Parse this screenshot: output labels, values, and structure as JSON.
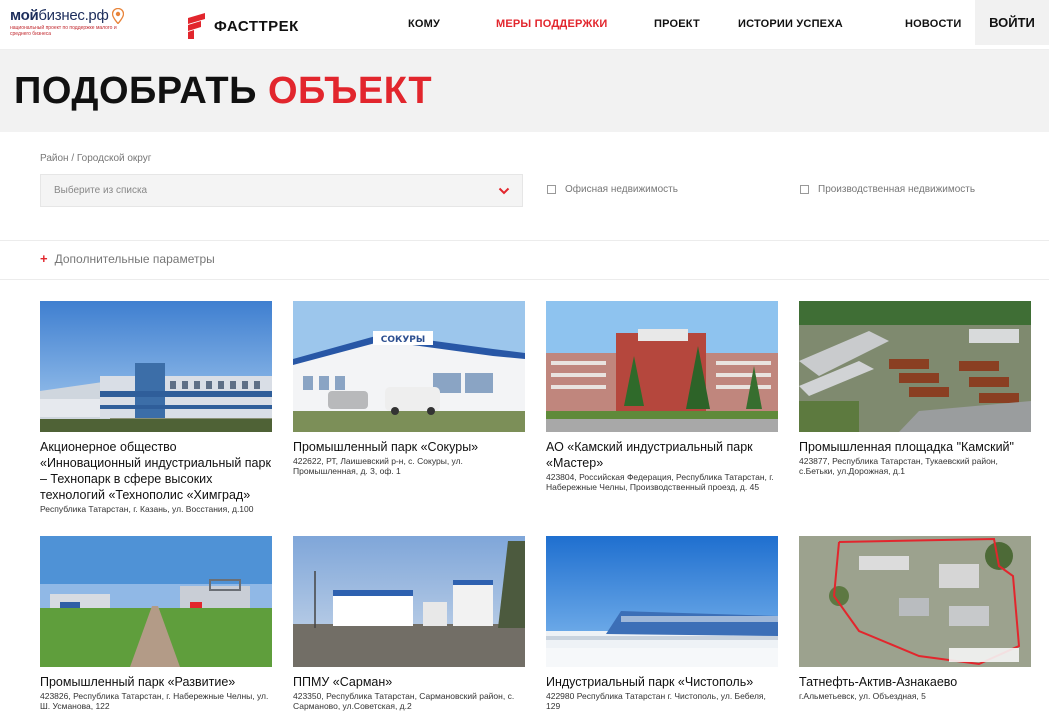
{
  "header": {
    "mb_logo": {
      "main_bold": "мой",
      "main_light": "бизнес.рф",
      "subtitle": "национальный проект по поддержке малого и среднего бизнеса"
    },
    "ft_logo": {
      "text": "ФАСТТРЕК"
    },
    "nav": [
      {
        "label": "КОМУ",
        "active": false
      },
      {
        "label": "МЕРЫ ПОДДЕРЖКИ",
        "active": true
      },
      {
        "label": "ПРОЕКТ",
        "active": false
      },
      {
        "label": "ИСТОРИИ УСПЕХА",
        "active": false
      },
      {
        "label": "НОВОСТИ",
        "active": false
      }
    ],
    "login": "ВОЙТИ"
  },
  "page": {
    "title_black": "ПОДОБРАТЬ ",
    "title_red": "ОБЪЕКТ"
  },
  "filters": {
    "district_label": "Район / Городской округ",
    "district_placeholder": "Выберите из списка",
    "office_label": "Офисная недвижимость",
    "production_label": "Производственная недвижимость",
    "extra_params": "Дополнительные параметры"
  },
  "cards": [
    {
      "title": "Акционерное общество «Инновационный индустриальный парк – Технопарк в сфере высоких технологий «Технополис «Химград»",
      "address": "Республика Татарстан, г. Казань, ул. Восстания, д.100"
    },
    {
      "title": "Промышленный парк «Сокуры»",
      "address": "422622, РТ, Лаишевский р-н, с. Сокуры, ул. Промышленная, д. 3, оф. 1",
      "sign": "СОКУРЫ"
    },
    {
      "title": "АО «Камский индустриальный парк «Мастер»",
      "address": "423804, Российская Федерация, Республика Татарстан, г. Набережные Челны, Производственный проезд, д. 45"
    },
    {
      "title": "Промышленная площадка \"Камский\"",
      "address": "423877, Республика Татарстан, Тукаевский район, с.Бетьки, ул.Дорожная, д.1"
    },
    {
      "title": "Промышленный парк «Развитие»",
      "address": "423826, Республика Татарстан, г. Набережные Челны, ул. Ш. Усманова, 122"
    },
    {
      "title": "ППМУ «Сарман»",
      "address": "423350, Республика Татарстан, Сармановский район, с. Сарманово, ул.Советская, д.2"
    },
    {
      "title": "Индустриальный парк «Чистополь»",
      "address": "422980 Республика Татарстан г. Чистополь, ул. Бебеля, 129"
    },
    {
      "title": "Татнефть-Актив-Азнакаево",
      "address": "г.Альметьевск, ул. Объездная, 5"
    }
  ]
}
